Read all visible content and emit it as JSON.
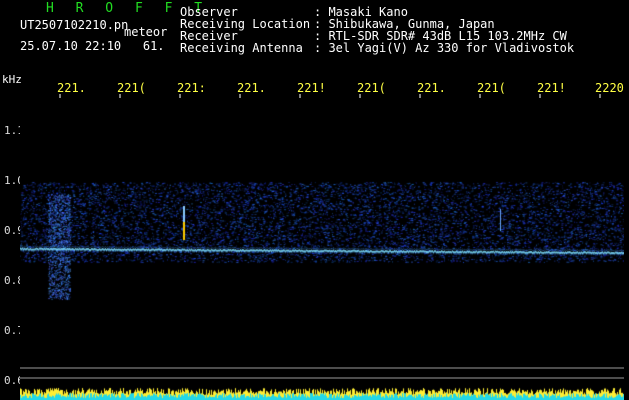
{
  "header": {
    "program": "H R O F F T",
    "filename": "UT2507102210.pn",
    "filename_suffix": "meteor",
    "datetime": "25.07.10 22:10",
    "datetime_value": "61.",
    "fields": [
      {
        "label": "Observer",
        "value": ": Masaki Kano"
      },
      {
        "label": "Receiving Location",
        "value": ": Shibukawa, Gunma, Japan"
      },
      {
        "label": "Receiver",
        "value": ": RTL-SDR SDR# 43dB L15 103.2MHz CW"
      },
      {
        "label": "Receiving Antenna",
        "value": ": 3el Yagi(V) Az 330 for Vladivostok"
      }
    ]
  },
  "axes": {
    "y_unit": "kHz",
    "x_ticks": [
      "221.",
      "221(",
      "221:",
      "221.",
      "221!",
      "221(",
      "221.",
      "221(",
      "221!",
      "2220"
    ],
    "y_ticks": [
      "1.1",
      "1.0",
      "0.9",
      "0.8",
      "0.7",
      "0.6"
    ]
  },
  "colors": {
    "background": "#000000",
    "signal_carrier": "#7fe0ff",
    "noise": "#1030c0",
    "meteor_echo": "#ffcc00",
    "bar_yellow": "#ffee33",
    "bar_cyan": "#22d8e8",
    "guide_lines": "#9a9a9a",
    "header_program": "#22dd22",
    "tick_label": "#ffff44"
  }
}
